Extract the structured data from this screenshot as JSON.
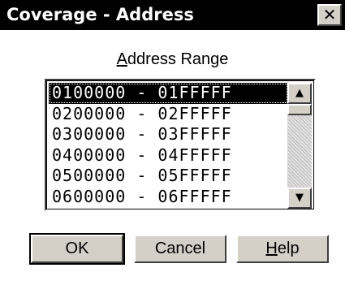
{
  "window": {
    "title": "Coverage - Address",
    "close_label": "✕"
  },
  "group": {
    "label_mnemonic": "A",
    "label_rest": "ddress Range"
  },
  "list": {
    "items": [
      "0100000 - 01FFFFF",
      "0200000 - 02FFFFF",
      "0300000 - 03FFFFF",
      "0400000 - 04FFFFF",
      "0500000 - 05FFFFF",
      "0600000 - 06FFFFF"
    ],
    "selected_index": 0,
    "scroll_up": "▲",
    "scroll_down": "▼"
  },
  "buttons": {
    "ok": "OK",
    "cancel": "Cancel",
    "help_mnemonic": "H",
    "help_rest": "elp"
  }
}
